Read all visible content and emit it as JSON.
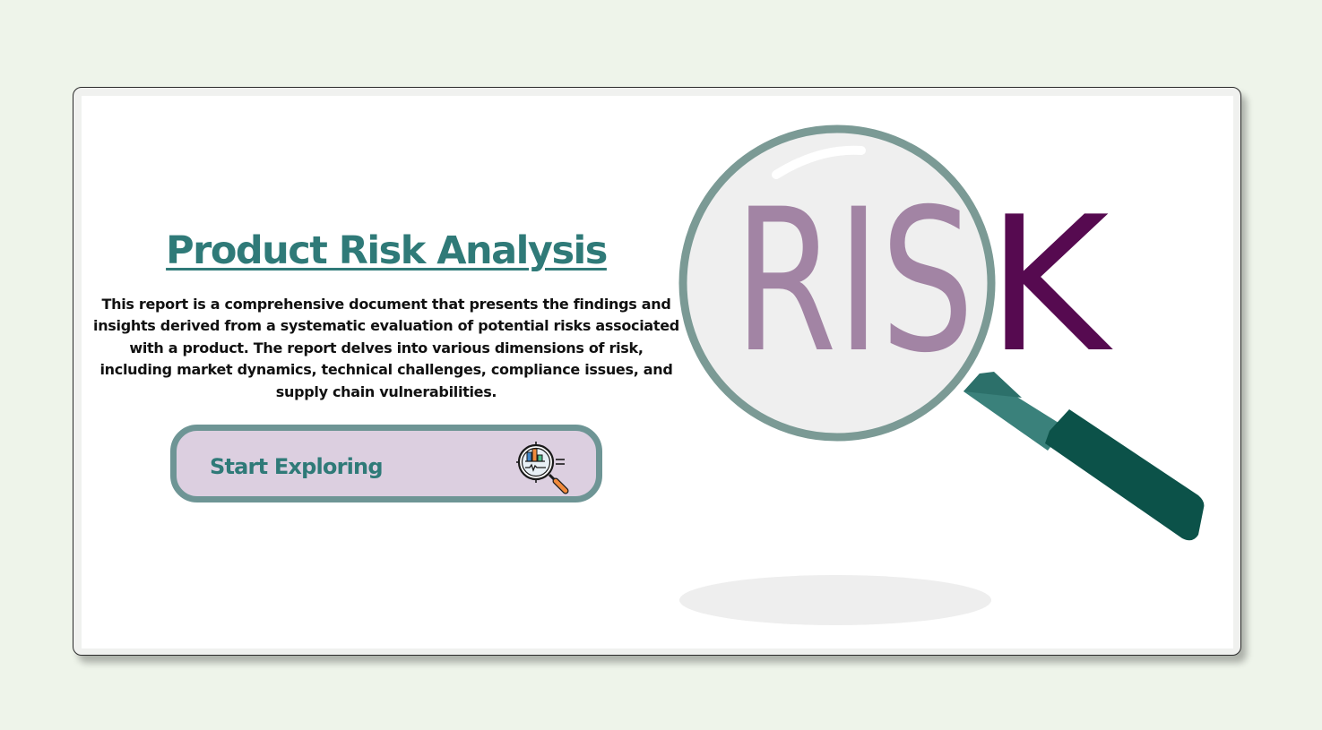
{
  "hero": {
    "title": "Product Risk Analysis",
    "description": "This report is a comprehensive document that presents the findings and insights derived from a systematic evaluation of potential risks associated with a product. The report delves into various dimensions of risk, including market dynamics, technical challenges, compliance issues, and supply chain vulnerabilities.",
    "cta_label": "Start Exploring",
    "cta_icon": "magnifier-chart-icon"
  },
  "illustration": {
    "word_inside_lens": "RIS",
    "word_outside_lens": "K",
    "icon": "magnifying-glass-icon"
  },
  "colors": {
    "page_background": "#eef4ea",
    "card_background": "#ffffff",
    "accent_teal": "#2f7a78",
    "button_fill": "#dccfe0",
    "button_border": "#6e9595",
    "risk_text_lens": "#a284a4",
    "risk_text_outside": "#560a50",
    "lens_rim": "#7b9a95",
    "handle": "#0c5249"
  }
}
